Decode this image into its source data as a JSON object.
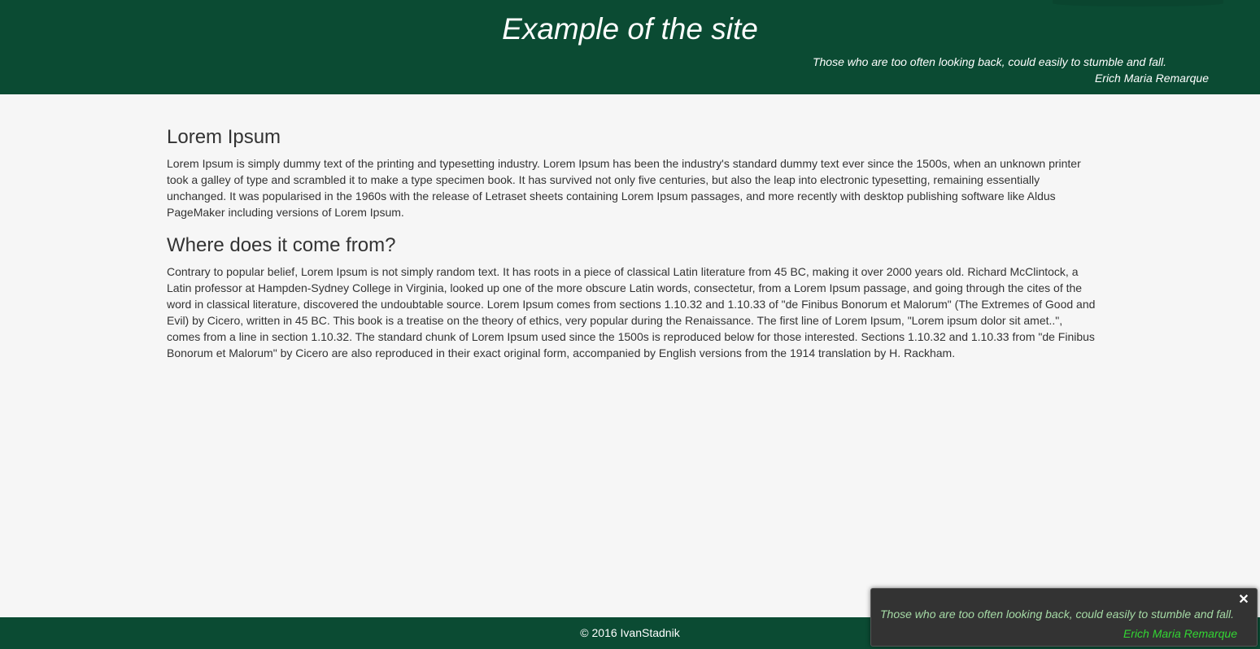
{
  "header": {
    "title": "Example of the site",
    "quote": "Those who are too often looking back, could easily to stumble and fall.",
    "author": "Erich Maria Remarque",
    "background_color": "#0b4b33"
  },
  "main": {
    "sections": [
      {
        "heading": "Lorem Ipsum",
        "body": "Lorem Ipsum is simply dummy text of the printing and typesetting industry. Lorem Ipsum has been the industry's standard dummy text ever since the 1500s, when an unknown printer took a galley of type and scrambled it to make a type specimen book. It has survived not only five centuries, but also the leap into electronic typesetting, remaining essentially unchanged. It was popularised in the 1960s with the release of Letraset sheets containing Lorem Ipsum passages, and more recently with desktop publishing software like Aldus PageMaker including versions of Lorem Ipsum."
      },
      {
        "heading": "Where does it come from?",
        "body": "Contrary to popular belief, Lorem Ipsum is not simply random text. It has roots in a piece of classical Latin literature from 45 BC, making it over 2000 years old. Richard McClintock, a Latin professor at Hampden-Sydney College in Virginia, looked up one of the more obscure Latin words, consectetur, from a Lorem Ipsum passage, and going through the cites of the word in classical literature, discovered the undoubtable source. Lorem Ipsum comes from sections 1.10.32 and 1.10.33 of \"de Finibus Bonorum et Malorum\" (The Extremes of Good and Evil) by Cicero, written in 45 BC. This book is a treatise on the theory of ethics, very popular during the Renaissance. The first line of Lorem Ipsum, \"Lorem ipsum dolor sit amet..\", comes from a line in section 1.10.32. The standard chunk of Lorem Ipsum used since the 1500s is reproduced below for those interested. Sections 1.10.32 and 1.10.33 from \"de Finibus Bonorum et Malorum\" by Cicero are also reproduced in their exact original form, accompanied by English versions from the 1914 translation by H. Rackham."
      }
    ]
  },
  "footer": {
    "copyright": "© 2016 IvanStadnik"
  },
  "toast": {
    "close_icon": "close-icon",
    "close_glyph": "✕",
    "quote": "Those who are too often looking back, could easily to stumble and fall.",
    "author": "Erich Maria Remarque",
    "quote_color": "#a6dba6",
    "author_color": "#33d633"
  }
}
